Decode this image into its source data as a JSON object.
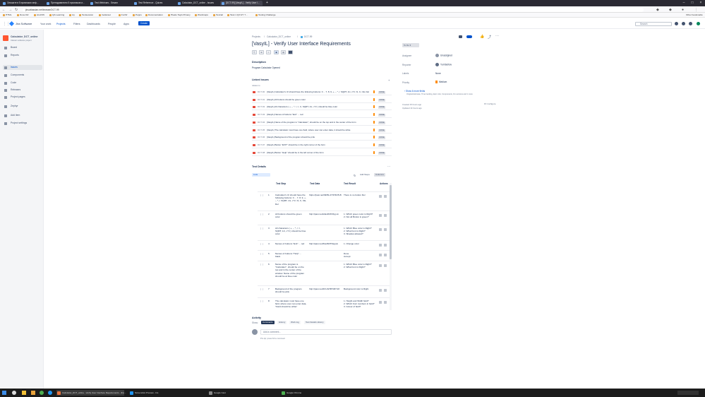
{
  "browser": {
    "tabs": [
      {
        "label": "Опишите в 5 признаках инф..."
      },
      {
        "label": "Преподавателю 5 признаков и..."
      },
      {
        "label": "Test Webinars - Sesam"
      },
      {
        "label": "Test Reference - Quizes"
      },
      {
        "label": "Calculator_DCT_online - Issues"
      },
      {
        "label": "[DCT-99] [VasyIL] - Verify User I..."
      }
    ],
    "url": "jira.atlassian.net/browse/DCT-99",
    "bookmarks": [
      "HTML",
      "Done Diz",
      "ALLINN",
      "QA Learning",
      "Ivy",
      "Testsession",
      "Iredanset",
      "FunW",
      "Pepps",
      "Documentation",
      "Hlealo Tayis Privacy",
      "Wordmaps",
      "Testrail",
      "Task 1 Q3 F/Y 7...",
      "Testing Challenge"
    ],
    "other_bookmarks": "Other bookmarks"
  },
  "jira": {
    "logo": "Jira Software",
    "nav": [
      "Your work",
      "Projects",
      "Filters",
      "Dashboards",
      "People",
      "Apps"
    ],
    "create": "Create",
    "search_placeholder": "Search"
  },
  "sidebar": {
    "project_name": "Calculator_DCT_online",
    "project_type": "Classic software project",
    "items": [
      {
        "label": "Board"
      },
      {
        "label": "Reports"
      },
      {
        "label": "Issues"
      },
      {
        "label": "Components"
      },
      {
        "label": "Code"
      },
      {
        "label": "Releases"
      },
      {
        "label": "Project pages"
      },
      {
        "label": "Zephyr"
      },
      {
        "label": "Add item"
      },
      {
        "label": "Project settings"
      }
    ]
  },
  "issue": {
    "breadcrumb": [
      "Projects",
      "Calculator_DCT_online",
      "DCT-99"
    ],
    "title": "[VasyIL] - Verify User Interface Requirements",
    "description_label": "Description",
    "description": "Program Calculator Opened",
    "linked_label": "Linked issues",
    "linked_sub": "relates to",
    "linked": [
      {
        "key": "DCT-90",
        "summary": "[VasyIL] Calculator's UI should have the following buttons: 0 ... 7, 8, 9, +, -, *, /, SQRT, 1/x, x^2, %, C, CE, Del",
        "status": "DONE"
      },
      {
        "key": "DCT-91",
        "summary": "[VasyIL] All buttons should be green color",
        "status": "DONE"
      },
      {
        "key": "DCT-92",
        "summary": "[VasyIL] All characters ( +, -, *, /, =, C, SQRT, 1/x, x^2 ) should be blue color",
        "status": "DONE"
      },
      {
        "key": "DCT-93",
        "summary": "[VasyIL] Names of buttons \"Exit\" ... red",
        "status": "DONE"
      },
      {
        "key": "DCT-94",
        "summary": "[VasyIL] Name of the program is \"Calculator\", should be on the top and in the center of the form",
        "status": "DONE"
      },
      {
        "key": "DCT-95",
        "summary": "[VasyIL] The calculator must have one field, where user can enter data, it should be white",
        "status": "DONE"
      },
      {
        "key": "DCT-96",
        "summary": "[VasyIL] Background of the program should be pink",
        "status": "DONE"
      },
      {
        "key": "DCT-97",
        "summary": "[VasyIL] Button \"EXIT\" should be in the right corner of the form",
        "status": "DONE"
      },
      {
        "key": "DCT-98",
        "summary": "[VasyIL] Button \"Help\" should be in the left corner of the form",
        "status": "DONE"
      }
    ],
    "test_details_label": "Test Details",
    "details_select": "Lists",
    "add_steps": "Add Steps",
    "columns_btn": "Columns",
    "table_headers": [
      "Test Step",
      "Test Data",
      "Test Result",
      "Actions"
    ],
    "steps": [
      {
        "n": "1",
        "step": "Calculator's UI should have the following buttons: 0 ... 7, 8, 9, +, -, *, /, SQRT, 1/x, x^2, %, C, CE, Del",
        "data": "https://pasi.net/6iD5L4Yf47RJ5-B",
        "result": "There is no button Del"
      },
      {
        "n": "2",
        "step": "All buttons should be green color",
        "data": "http://pasi.net/wfasRrW3byj-vk",
        "result": "1. Which green color is Right?\n2. Not all Button is green?"
      },
      {
        "n": "3",
        "step": "All characters ( +, -, *, /, =, SQRT, 1/x, x^2 ) should be blue color",
        "data": "",
        "result": "1. Which Blue color is Right?\n2. What Font is Right?\n3. Shadow allowed?"
      },
      {
        "n": "4",
        "step": "Names of buttons \"Exit\" ... red",
        "data": "http://pasi.net/3iwdN3TDjsyuk",
        "result": "1. Change color"
      },
      {
        "n": "5",
        "step": "Names of buttons \"Help\" ... black",
        "data": "",
        "result": "Done\nAccept"
      },
      {
        "n": "6",
        "step": "Name of the program is \"Calculator\", should be on the top and in the center of the window. Name of the program should be at blue color",
        "data": "",
        "result": "1. Which Blue color is Right?\n2. What Font is Right?"
      },
      {
        "n": "7",
        "step": "Background of the program should be pink",
        "data": "http://pasi.net/4CUrkHPNRYU8",
        "result": "Background color is Right"
      },
      {
        "n": "8",
        "step": "The calculator must have one field, where user can enter data, \"Field should be white\"",
        "data": "",
        "result": "1. Height and Width field?\n2. Which Font numbers in field?\n3. Colour of field?"
      }
    ],
    "activity_label": "Activity",
    "activity_show": "Show:",
    "activity_tabs": [
      "Comments",
      "History",
      "Work log",
      "Test Details History"
    ],
    "comment_placeholder": "Add a comment...",
    "protip": "Pro tip: press M to comment"
  },
  "right": {
    "status_btn": "To Do",
    "fields": [
      {
        "label": "Assignee",
        "value": "Unassigned"
      },
      {
        "label": "Reporter",
        "value": "Yuri Belhov"
      },
      {
        "label": "Labels",
        "value": "None"
      },
      {
        "label": "Priority",
        "value": "Medium"
      }
    ],
    "more_fields": "Show 6 more fields",
    "more_fields_sub": "Original Estimate, Time tracking, Epic Link, Components, Fix versions and 1 more",
    "created": "Created 15 hours ago",
    "updated": "Updated 14 hours ago",
    "configure": "Configure"
  },
  "taskbar": {
    "items": [
      "Calculator_DCT_online - Verify User Interface Requirements - Jira ...",
      "Screenshot Preview - Iris",
      "Google Cast",
      "Google Chrome"
    ]
  },
  "colors": {
    "brand": "#0052cc",
    "tabbar": "#2b2a33",
    "bug": "#e5493a",
    "priority": "#ff8b00"
  }
}
